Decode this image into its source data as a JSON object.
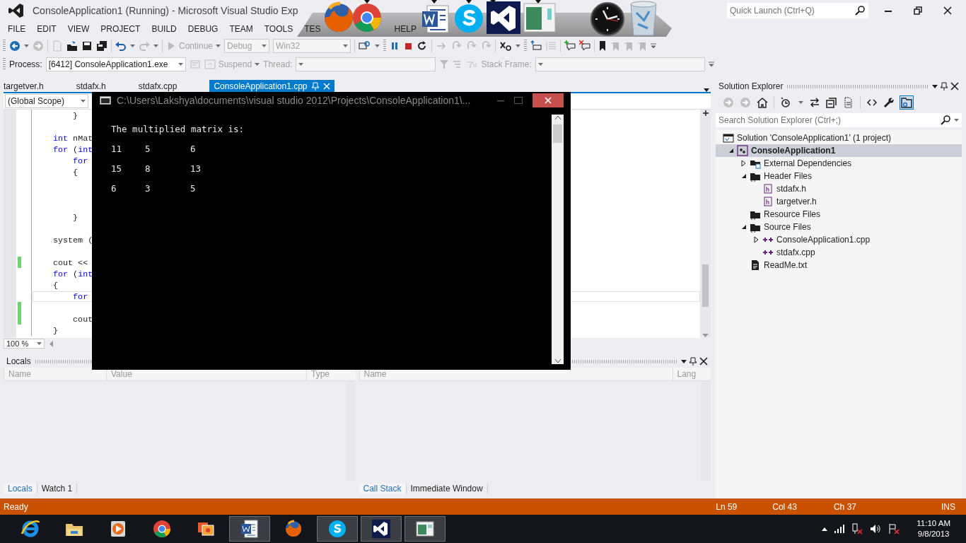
{
  "window": {
    "title": "ConsoleApplication1 (Running) - Microsoft Visual Studio Exp",
    "quick_launch": {
      "placeholder": "Quick Launch (Ctrl+Q)"
    }
  },
  "menu": [
    "FILE",
    "EDIT",
    "VIEW",
    "PROJECT",
    "BUILD",
    "DEBUG",
    "TEAM",
    "TOOLS",
    "TES",
    "HELP"
  ],
  "toolbar": {
    "continue": {
      "label": "Continue",
      "disabled": true
    },
    "configuration": {
      "value": "Debug",
      "disabled": true
    },
    "platform": {
      "value": "Win32",
      "disabled": true
    }
  },
  "debug_location": {
    "process_label": "Process:",
    "process": "[6412] ConsoleApplication1.exe",
    "suspend": {
      "label": "Suspend",
      "disabled": true
    },
    "thread_label": "Thread:",
    "stack_frame_label": "Stack Frame:"
  },
  "doc_tabs": [
    {
      "label": "targetver.h",
      "selected": false
    },
    {
      "label": "stdafx.h",
      "selected": false
    },
    {
      "label": "stdafx.cpp",
      "selected": false
    },
    {
      "label": "ConsoleApplication1.cpp",
      "selected": true
    }
  ],
  "editor": {
    "scope": "(Global Scope)",
    "zoom": "100 %",
    "lines": [
      {
        "tokens": [
          {
            "kind": "plain",
            "text": "        }"
          }
        ],
        "changed": false,
        "current": false
      },
      {
        "changed": false,
        "current": false
      },
      {
        "tokens": [
          {
            "kind": "keyword",
            "text": "    int"
          },
          {
            "kind": "plain",
            "text": " nMat"
          }
        ],
        "changed": false,
        "current": false
      },
      {
        "tokens": [
          {
            "kind": "keyword",
            "text": "    for"
          },
          {
            "kind": "plain",
            "text": " ("
          },
          {
            "kind": "keyword",
            "text": "int"
          }
        ],
        "changed": false,
        "current": false
      },
      {
        "tokens": [
          {
            "kind": "keyword",
            "text": "        for"
          }
        ],
        "changed": false,
        "current": false
      },
      {
        "tokens": [
          {
            "kind": "plain",
            "text": "        {"
          }
        ],
        "changed": false,
        "current": false
      },
      {
        "changed": false,
        "current": false
      },
      {
        "changed": false,
        "current": false
      },
      {
        "changed": false,
        "current": false
      },
      {
        "tokens": [
          {
            "kind": "plain",
            "text": "        }"
          }
        ],
        "changed": false,
        "current": false
      },
      {
        "changed": false,
        "current": false
      },
      {
        "tokens": [
          {
            "kind": "plain",
            "text": "    system ("
          }
        ],
        "changed": false,
        "current": false
      },
      {
        "changed": false,
        "current": false
      },
      {
        "tokens": [
          {
            "kind": "plain",
            "text": "    cout <<"
          }
        ],
        "changed": true,
        "current": false
      },
      {
        "tokens": [
          {
            "kind": "keyword",
            "text": "    for"
          },
          {
            "kind": "plain",
            "text": " ("
          },
          {
            "kind": "keyword",
            "text": "int"
          }
        ],
        "changed": false,
        "current": false
      },
      {
        "tokens": [
          {
            "kind": "plain",
            "text": "    {"
          }
        ],
        "changed": false,
        "current": false
      },
      {
        "tokens": [
          {
            "kind": "keyword",
            "text": "        for"
          }
        ],
        "changed": false,
        "current": true
      },
      {
        "changed": true,
        "current": false
      },
      {
        "tokens": [
          {
            "kind": "plain",
            "text": "        cout"
          }
        ],
        "changed": true,
        "current": false
      },
      {
        "tokens": [
          {
            "kind": "plain",
            "text": "    }"
          }
        ],
        "changed": false,
        "current": false
      }
    ]
  },
  "console": {
    "title": "C:\\Users\\Lakshya\\documents\\visual studio 2012\\Projects\\ConsoleApplication1\\...",
    "heading": "The multiplied matrix is:",
    "matrix": [
      [
        "11",
        "5",
        "6"
      ],
      [
        "15",
        "8",
        "13"
      ],
      [
        "6",
        "3",
        "5"
      ]
    ]
  },
  "solution_explorer": {
    "title": "Solution Explorer",
    "search": {
      "placeholder": "Search Solution Explorer (Ctrl+;)"
    },
    "tree": [
      {
        "label": "Solution 'ConsoleApplication1' (1 project)",
        "kind": "solution",
        "selected": false,
        "children": [
          {
            "label": "ConsoleApplication1",
            "kind": "project",
            "selected": true,
            "expanded": true,
            "children": [
              {
                "label": "External Dependencies",
                "kind": "dependencies",
                "selected": false,
                "expanded": false
              },
              {
                "label": "Header Files",
                "kind": "folder",
                "selected": false,
                "expanded": true,
                "children": [
                  {
                    "label": "stdafx.h",
                    "kind": "header",
                    "selected": false
                  },
                  {
                    "label": "targetver.h",
                    "kind": "header",
                    "selected": false
                  }
                ]
              },
              {
                "label": "Resource Files",
                "kind": "folder",
                "selected": false
              },
              {
                "label": "Source Files",
                "kind": "folder",
                "selected": false,
                "expanded": true,
                "children": [
                  {
                    "label": "ConsoleApplication1.cpp",
                    "kind": "source",
                    "selected": false,
                    "expanded": false
                  },
                  {
                    "label": "stdafx.cpp",
                    "kind": "source",
                    "selected": false
                  }
                ]
              },
              {
                "label": "ReadMe.txt",
                "kind": "text",
                "selected": false
              }
            ]
          }
        ]
      }
    ]
  },
  "locals": {
    "title": "Locals",
    "columns": [
      "Name",
      "Value",
      "Type"
    ],
    "tabs": [
      {
        "label": "Locals",
        "selected": true
      },
      {
        "label": "Watch 1",
        "selected": false
      }
    ]
  },
  "call_stack": {
    "columns": [
      "Name",
      "Lang"
    ],
    "tabs": [
      {
        "label": "Call Stack",
        "selected": true
      },
      {
        "label": "Immediate Window",
        "selected": false
      }
    ]
  },
  "status_bar": {
    "message": "Ready",
    "line": "Ln 59",
    "column": "Col 43",
    "char": "Ch 37",
    "mode": "INS"
  },
  "taskbar": {
    "apps": [
      {
        "kind": "ie",
        "active": false
      },
      {
        "kind": "folder",
        "active": false
      },
      {
        "kind": "media",
        "active": false
      },
      {
        "kind": "chrome",
        "active": false
      },
      {
        "kind": "photos",
        "active": false
      },
      {
        "kind": "word",
        "active": true
      },
      {
        "kind": "firefox",
        "active": false
      },
      {
        "kind": "skype",
        "active": true
      },
      {
        "kind": "vs",
        "active": true
      },
      {
        "kind": "window",
        "active": true
      }
    ],
    "time": "11:10 AM",
    "date": "9/8/2013"
  }
}
